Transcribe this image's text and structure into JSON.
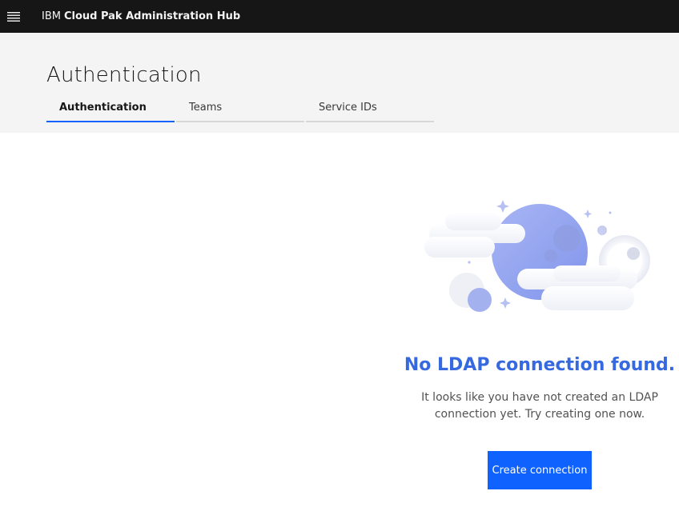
{
  "topbar": {
    "brand_prefix": "IBM",
    "brand_name": "Cloud Pak Administration Hub",
    "menu_icon": "hamburger-menu-icon"
  },
  "page": {
    "title": "Authentication"
  },
  "tabs": [
    {
      "label": "Authentication",
      "active": true
    },
    {
      "label": "Teams",
      "active": false
    },
    {
      "label": "Service IDs",
      "active": false
    }
  ],
  "empty_state": {
    "illustration": "moon-clouds-illustration",
    "title": "No LDAP connection found.",
    "description": "It looks like you have not created an LDAP connection yet. Try creating one now.",
    "button_label": "Create connection"
  },
  "colors": {
    "topbar": "#161616",
    "header_band": "#f4f4f4",
    "accent": "#0f62fe",
    "empty_title": "#3668e0"
  }
}
